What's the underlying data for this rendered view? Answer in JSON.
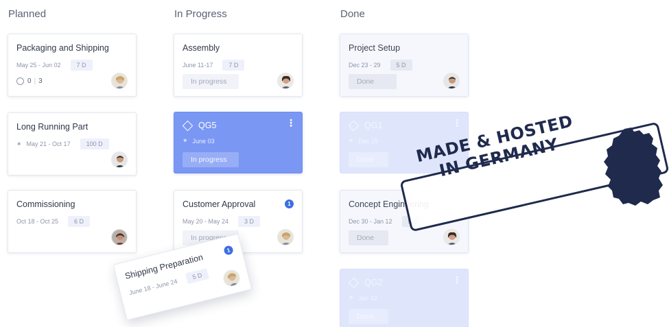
{
  "columns": {
    "planned": "Planned",
    "in_progress": "In Progress",
    "done": "Done"
  },
  "cards": {
    "packaging": {
      "title": "Packaging and Shipping",
      "dates": "May 25 - Jun 02",
      "duration": "7 D",
      "checks_done": "0",
      "checks_total": "3"
    },
    "long_running": {
      "title": "Long Running Part",
      "dates": "May 21 - Oct 17",
      "duration": "100 D"
    },
    "commissioning": {
      "title": "Commissioning",
      "dates": "Oct 18 - Oct 25",
      "duration": "6 D"
    },
    "assembly": {
      "title": "Assembly",
      "dates": "June 11-17",
      "duration": "7 D",
      "status": "In progress"
    },
    "qg5": {
      "title": "QG5",
      "date": "June 03",
      "status": "In progress"
    },
    "customer_approval": {
      "title": "Customer Approval",
      "dates": "May 20 - May 24",
      "duration": "3 D",
      "status": "In progress",
      "count": "1"
    },
    "project_setup": {
      "title": "Project Setup",
      "dates": "Dec 23 - 29",
      "duration": "5 D",
      "status": "Done"
    },
    "qg1": {
      "title": "QG1",
      "date": "Dec 29",
      "status": "Done"
    },
    "concept_engineering": {
      "title": "Concept Engineering",
      "dates": "Dec 30 - Jan 12",
      "duration": "5 D",
      "status": "Done"
    },
    "qg2": {
      "title": "QG2",
      "date": "Jan 12",
      "status": "Done"
    },
    "shipping_prep": {
      "title": "Shipping Preparation",
      "dates": "June 18 - June 24",
      "duration": "5 D",
      "count": "1"
    }
  },
  "stamp": {
    "line1": "MADE & HOSTED",
    "line2": "IN GERMANY"
  },
  "colors": {
    "milestone": "#7a97f3",
    "accent": "#3e6fe0",
    "stamp": "#1f2a4d"
  }
}
